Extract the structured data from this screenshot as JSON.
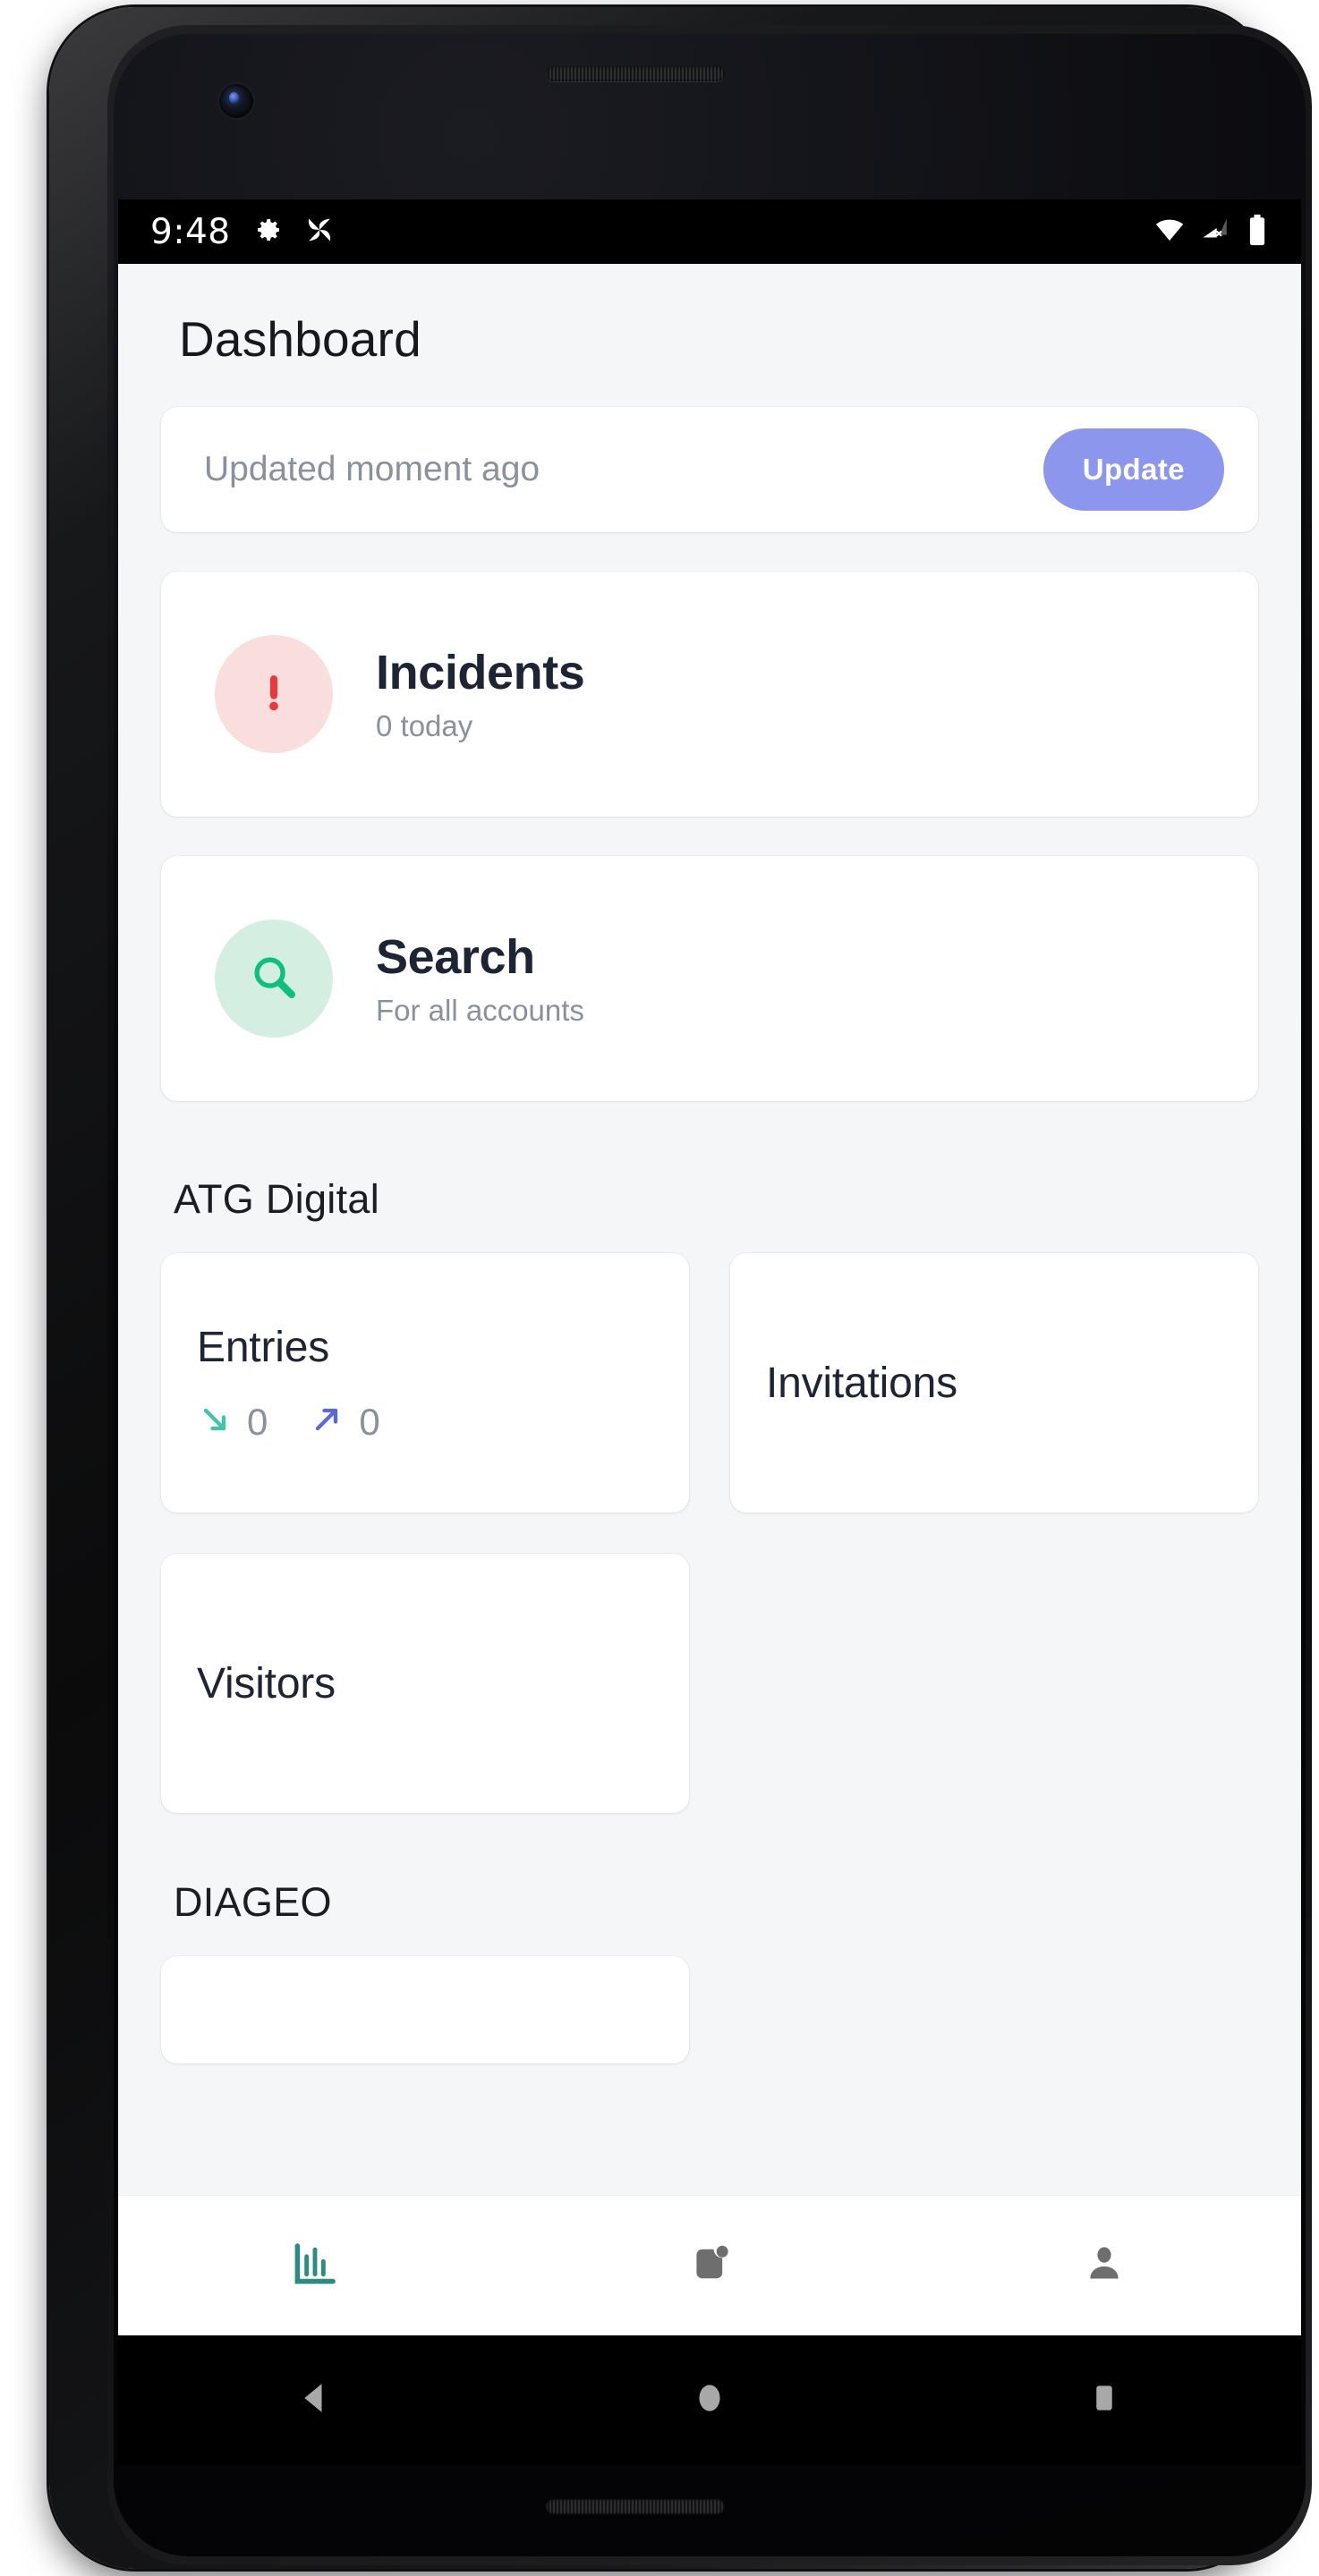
{
  "status_bar": {
    "clock": "9:48",
    "left_icons": [
      "gear-icon",
      "pinwheel-icon"
    ],
    "right_icons": [
      "wifi-icon",
      "cellular-no-sim-icon",
      "battery-full-icon"
    ]
  },
  "header": {
    "title": "Dashboard"
  },
  "update": {
    "status_text": "Updated moment ago",
    "button_label": "Update"
  },
  "rows": [
    {
      "title": "Incidents",
      "subtitle": "0 today",
      "icon": "exclamation-icon",
      "badge_bg": "#f9dedd",
      "icon_color": "#e8393c"
    },
    {
      "title": "Search",
      "subtitle": "For all accounts",
      "icon": "magnifier-icon",
      "badge_bg": "#d4efe2",
      "icon_color": "#0fbf7f"
    }
  ],
  "sections": [
    {
      "name": "ATG Digital",
      "tiles": [
        {
          "title": "Entries",
          "stats": [
            {
              "direction": "arrow-down-right-icon",
              "value": "0",
              "color": "#3fc6a4"
            },
            {
              "direction": "arrow-up-right-icon",
              "value": "0",
              "color": "#5b6ad0"
            }
          ]
        },
        {
          "title": "Invitations",
          "stats": []
        },
        {
          "title": "Visitors",
          "stats": []
        }
      ]
    },
    {
      "name": "DIAGEO",
      "tiles": []
    }
  ],
  "bottom_nav": {
    "items": [
      {
        "icon": "bar-chart-icon",
        "active": true,
        "color": "#2e8b84"
      },
      {
        "icon": "device-badge-icon",
        "active": false,
        "color": "#6e6e6e"
      },
      {
        "icon": "person-icon",
        "active": false,
        "color": "#6e6e6e"
      }
    ]
  },
  "android_nav": {
    "keys": [
      "back-triangle-icon",
      "home-circle-icon",
      "recents-square-icon"
    ]
  },
  "colors": {
    "screen_bg": "#f4f6f8",
    "card_bg": "#ffffff",
    "accent_indigo": "#8b96ec",
    "text_dark": "#1d2433",
    "text_muted": "#8a919e",
    "teal": "#2e8b84"
  }
}
